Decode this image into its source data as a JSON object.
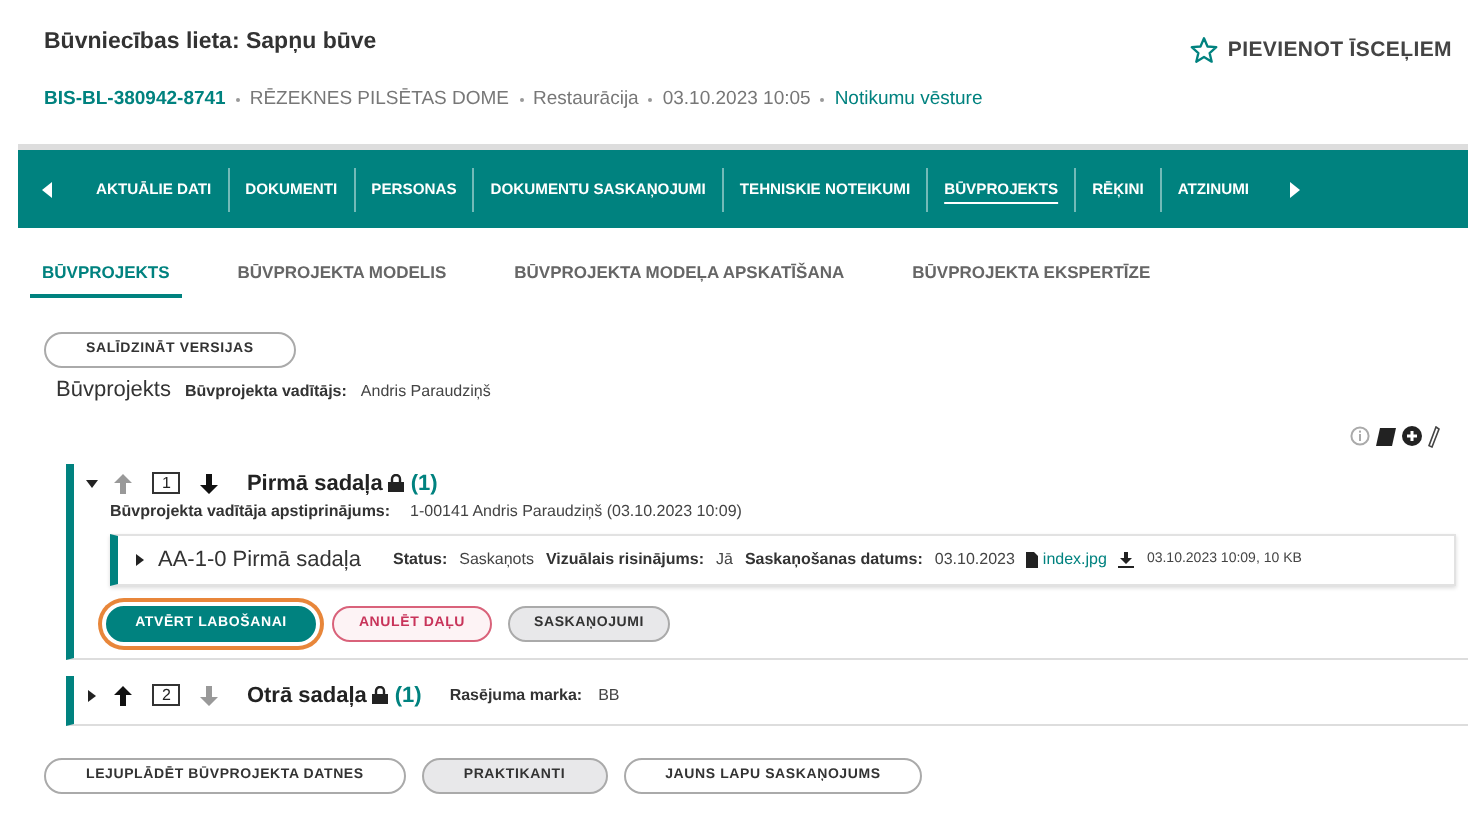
{
  "header": {
    "title": "Būvniecības lieta: Sapņu būve",
    "favorite_label": "PIEVIENOT ĪSCEĻIEM",
    "case_id": "BIS-BL-380942-8741",
    "meta": [
      "RĒZEKNES PILSĒTAS DOME",
      "Restaurācija",
      "03.10.2023 10:05"
    ],
    "history_link": "Notikumu vēsture"
  },
  "nav_tabs": [
    {
      "label": "AKTUĀLIE DATI",
      "selected": false
    },
    {
      "label": "DOKUMENTI",
      "selected": false
    },
    {
      "label": "PERSONAS",
      "selected": false
    },
    {
      "label": "DOKUMENTU SASKAŅOJUMI",
      "selected": false
    },
    {
      "label": "TEHNISKIE NOTEIKUMI",
      "selected": false
    },
    {
      "label": "BŪVPROJEKTS",
      "selected": true
    },
    {
      "label": "RĒĶINI",
      "selected": false
    },
    {
      "label": "ATZINUMI",
      "selected": false
    }
  ],
  "sub_tabs": [
    {
      "label": "BŪVPROJEKTS",
      "selected": true
    },
    {
      "label": "BŪVPROJEKTA MODELIS",
      "selected": false
    },
    {
      "label": "BŪVPROJEKTA MODEĻA APSKATĪŠANA",
      "selected": false
    },
    {
      "label": "BŪVPROJEKTA EKSPERTĪZE",
      "selected": false
    }
  ],
  "compare_button": "SALĪDZINĀT VERSIJAS",
  "project": {
    "title": "Būvprojekts",
    "manager_label": "Būvprojekta vadītājs:",
    "manager": "Andris Paraudziņš"
  },
  "sections": [
    {
      "expanded": true,
      "up_enabled": false,
      "down_enabled": true,
      "number": "1",
      "title": "Pirmā sadaļa",
      "count": "(1)",
      "fields": [
        {
          "label": "Būvprojekta vadītāja apstiprinājums:",
          "value": "1-00141 Andris Paraudziņš (03.10.2023 10:09)"
        }
      ],
      "items": [
        {
          "expanded": false,
          "title": "AA-1-0 Pirmā sadaļa",
          "status_label": "Status:",
          "status": "Saskaņots",
          "visual_label": "Vizuālais risinājums:",
          "visual": "Jā",
          "date_label": "Saskaņošanas datums:",
          "date": "03.10.2023",
          "file": "index.jpg",
          "file_info": "03.10.2023 10:09, 10 KB"
        }
      ],
      "buttons": [
        {
          "label": "ATVĒRT LABOŠANAI",
          "kind": "primary",
          "highlighted": true
        },
        {
          "label": "ANULĒT DAĻU",
          "kind": "danger",
          "highlighted": false
        },
        {
          "label": "SASKAŅOJUMI",
          "kind": "secondary",
          "highlighted": false
        }
      ]
    },
    {
      "expanded": false,
      "up_enabled": true,
      "down_enabled": false,
      "number": "2",
      "title": "Otrā sadaļa",
      "count": "(1)",
      "fields": [
        {
          "label": "Rasējuma marka:",
          "value": "BB"
        }
      ]
    }
  ],
  "bottom_buttons": [
    {
      "label": "LEJUPLĀDĒT BŪVPROJEKTA DATNES",
      "kind": "outline"
    },
    {
      "label": "PRAKTIKANTI",
      "kind": "grey"
    },
    {
      "label": "JAUNS LAPU SASKAŅOJUMS",
      "kind": "outline"
    }
  ]
}
